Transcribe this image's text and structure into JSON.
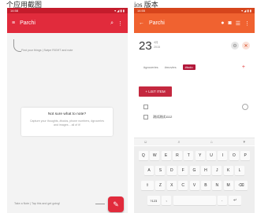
{
  "caption": {
    "left": "个应用截图",
    "right": "ios 版本"
  },
  "colors": {
    "p1_primary": "#e12b3c",
    "p2_primary": "#f06230",
    "tag_selected": "#b3183a",
    "list_button": "#c4283f"
  },
  "p1": {
    "status": {
      "time": "14:58",
      "icons": "▾ ◢ ▮ ▮"
    },
    "appbar": {
      "menu_icon": "≡",
      "title": "Parchi",
      "search_icon": "⌕",
      "more_icon": "⋮"
    },
    "hint_top": "Find your things | Swipe RIGHT and note",
    "card": {
      "heading": "Not sure what to note?",
      "body": "Capture your thoughts, #todos, phone numbers, #groceries and images... all of it!"
    },
    "hint_bottom": "Take a Note | Tap this and get going!",
    "fab_icon": "✎"
  },
  "p2": {
    "status": {
      "time": "14:55",
      "icons": "▾ ◢ ▮ ▮"
    },
    "appbar": {
      "back_icon": "←",
      "title": "Parchi",
      "palette_icon": "●",
      "camera_icon": "◙",
      "list_icon": "☰",
      "more_icon": "⋮"
    },
    "date": {
      "day": "23",
      "month": "4月",
      "year": "2015"
    },
    "date_icons": [
      "⚙",
      "✕"
    ],
    "tags": [
      "#groceries",
      "#movies",
      "#todo"
    ],
    "tag_add": "+",
    "list_button": "+ LIST ITEM",
    "items": [
      "",
      "测试测试1112"
    ],
    "keyboard": {
      "top": [
        "☺",
        "⌕",
        "⌂",
        "▾"
      ],
      "row1": [
        "Q",
        "W",
        "E",
        "R",
        "T",
        "Y",
        "U",
        "I",
        "O",
        "P"
      ],
      "row2": [
        "A",
        "S",
        "D",
        "F",
        "G",
        "H",
        "J",
        "K",
        "L"
      ],
      "row3": [
        "⇧",
        "Z",
        "X",
        "C",
        "V",
        "B",
        "N",
        "M",
        "⌫"
      ],
      "row4": [
        "?123",
        ",",
        "",
        ".",
        "↵"
      ]
    }
  }
}
